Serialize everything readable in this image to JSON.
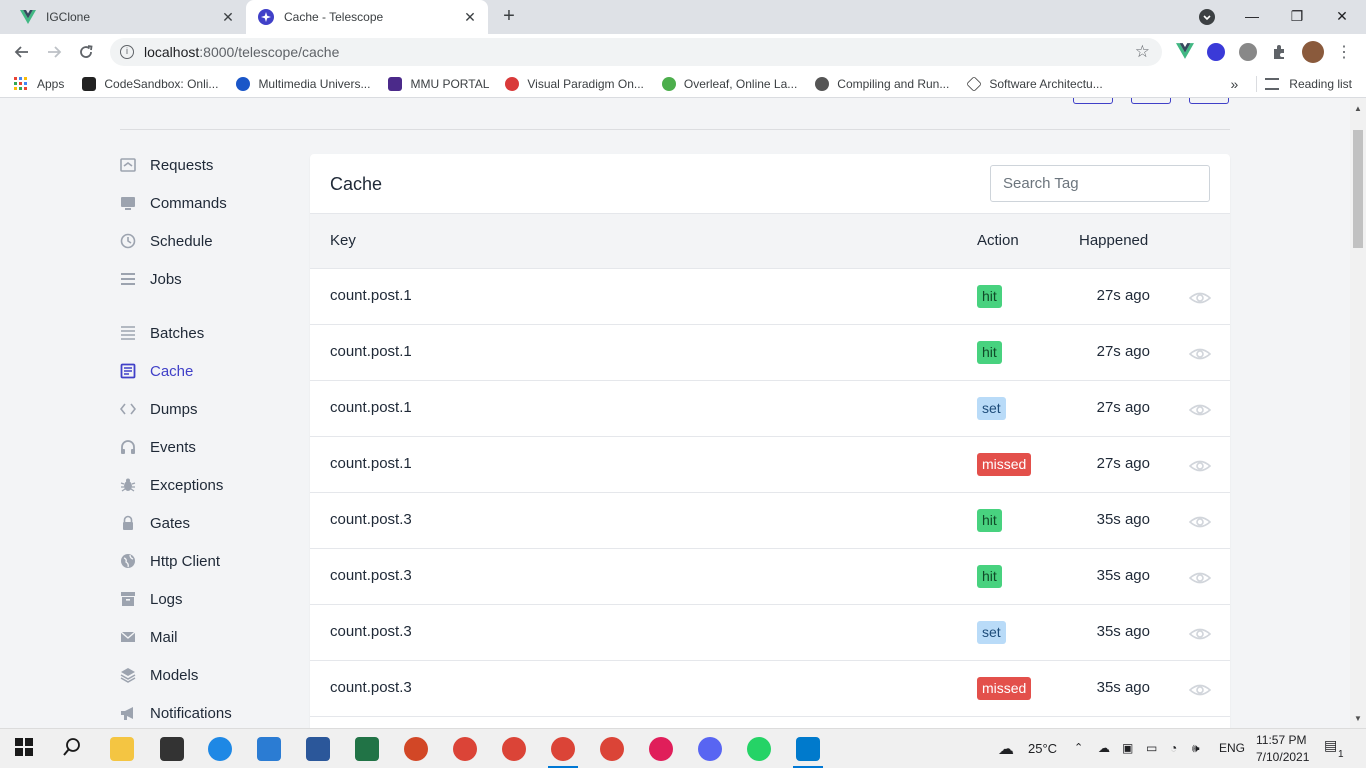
{
  "browser": {
    "tabs": [
      {
        "title": "IGClone",
        "active": false,
        "favicon": "vue-icon"
      },
      {
        "title": "Cache - Telescope",
        "active": true,
        "favicon": "telescope-icon"
      }
    ],
    "new_tab": "+",
    "window_controls": {
      "minimize": "—",
      "maximize": "❐",
      "close": "✕"
    },
    "url_host": "localhost",
    "url_path": ":8000/telescope/cache",
    "bookmarks": [
      "Apps",
      "CodeSandbox: Onli...",
      "Multimedia Univers...",
      "MMU PORTAL",
      "Visual Paradigm On...",
      "Overleaf, Online La...",
      "Compiling and Run...",
      "Software Architectu..."
    ],
    "bookmarks_more": "»",
    "reading_list": "Reading list"
  },
  "sidebar": {
    "items": [
      {
        "label": "Requests",
        "icon": "requests-icon",
        "active": false
      },
      {
        "label": "Commands",
        "icon": "commands-icon",
        "active": false
      },
      {
        "label": "Schedule",
        "icon": "schedule-icon",
        "active": false
      },
      {
        "label": "Jobs",
        "icon": "jobs-icon",
        "active": false
      },
      {
        "label": "Batches",
        "icon": "batches-icon",
        "active": false
      },
      {
        "label": "Cache",
        "icon": "cache-icon",
        "active": true
      },
      {
        "label": "Dumps",
        "icon": "dumps-icon",
        "active": false
      },
      {
        "label": "Events",
        "icon": "events-icon",
        "active": false
      },
      {
        "label": "Exceptions",
        "icon": "exceptions-icon",
        "active": false
      },
      {
        "label": "Gates",
        "icon": "gates-icon",
        "active": false
      },
      {
        "label": "Http Client",
        "icon": "http-client-icon",
        "active": false
      },
      {
        "label": "Logs",
        "icon": "logs-icon",
        "active": false
      },
      {
        "label": "Mail",
        "icon": "mail-icon",
        "active": false
      },
      {
        "label": "Models",
        "icon": "models-icon",
        "active": false
      },
      {
        "label": "Notifications",
        "icon": "notifications-icon",
        "active": false
      }
    ]
  },
  "card": {
    "title": "Cache",
    "search_placeholder": "Search Tag",
    "columns": [
      "Key",
      "Action",
      "Happened"
    ],
    "rows": [
      {
        "key": "count.post.1",
        "action": "hit",
        "happened": "27s ago"
      },
      {
        "key": "count.post.1",
        "action": "hit",
        "happened": "27s ago"
      },
      {
        "key": "count.post.1",
        "action": "set",
        "happened": "27s ago"
      },
      {
        "key": "count.post.1",
        "action": "missed",
        "happened": "27s ago"
      },
      {
        "key": "count.post.3",
        "action": "hit",
        "happened": "35s ago"
      },
      {
        "key": "count.post.3",
        "action": "hit",
        "happened": "35s ago"
      },
      {
        "key": "count.post.3",
        "action": "set",
        "happened": "35s ago"
      },
      {
        "key": "count.post.3",
        "action": "missed",
        "happened": "35s ago"
      }
    ]
  },
  "colors": {
    "accent": "#4040c8",
    "hit": "#48d27f",
    "set": "#b9dbf8",
    "missed": "#e3504b"
  },
  "taskbar": {
    "weather": "25°C",
    "language": "ENG",
    "time": "11:57 PM",
    "date": "7/10/2021",
    "notifications": "1"
  }
}
